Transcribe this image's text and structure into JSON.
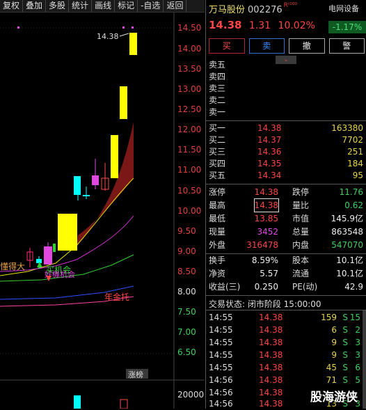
{
  "toolbar": {
    "items": [
      "复权",
      "叠加",
      "多股",
      "统计",
      "画线",
      "标记",
      "-自选",
      "返回"
    ]
  },
  "chart": {
    "price_axis_labels": [
      "14.50",
      "14.00",
      "13.50",
      "13.00",
      "12.50",
      "12.00",
      "11.50",
      "11.00",
      "10.50",
      "10.00",
      "9.50",
      "9.00",
      "8.50",
      "8.00",
      "7.50",
      "7.00",
      "6.50"
    ],
    "high_label": "14.38",
    "annotations": {
      "label1": "懂得大",
      "label2": "买机会",
      "label3": "好機机会",
      "label4": "年金托"
    },
    "zhangbang_label": "涨榜",
    "volume_axis_label": "20000",
    "colors": {
      "up_candle": "#ff2a7a",
      "limit_up_candle": "#ffff00",
      "down_candle": "#00ffff",
      "ma_yellow": "#e8e000",
      "ma_magenta": "#d030d0",
      "ma_green": "#30d030",
      "ma_blue": "#3050ff",
      "cloud": "#7a1515"
    }
  },
  "header": {
    "stock_name": "万马股份",
    "stock_code": "002276",
    "r_tag": "R⁽⁰⁰⁰",
    "sector_name": "电网设备",
    "price": "14.38",
    "change": "1.31",
    "change_pct": "10.02%",
    "sector_pct": "-1.17%"
  },
  "buttons": {
    "buy": "买",
    "sell": "卖",
    "cancel": "撤",
    "warn": "警"
  },
  "fold_icon": "chevron-down-double",
  "asks": [
    {
      "label": "卖五",
      "price": "",
      "vol": ""
    },
    {
      "label": "卖四",
      "price": "",
      "vol": ""
    },
    {
      "label": "卖三",
      "price": "",
      "vol": ""
    },
    {
      "label": "卖二",
      "price": "",
      "vol": ""
    },
    {
      "label": "卖一",
      "price": "",
      "vol": ""
    }
  ],
  "bids": [
    {
      "label": "买一",
      "price": "14.38",
      "vol": "163380"
    },
    {
      "label": "买二",
      "price": "14.37",
      "vol": "7702"
    },
    {
      "label": "买三",
      "price": "14.36",
      "vol": "251"
    },
    {
      "label": "买四",
      "price": "14.35",
      "vol": "184"
    },
    {
      "label": "买五",
      "price": "14.34",
      "vol": "95"
    }
  ],
  "stats": [
    {
      "l1": "涨停",
      "v1": "14.38",
      "c1": "red",
      "l2": "跌停",
      "v2": "11.76",
      "c2": "green"
    },
    {
      "l1": "最高",
      "v1": "14.38",
      "c1": "red",
      "l2": "量比",
      "v2": "0.62",
      "c2": "green"
    },
    {
      "l1": "最低",
      "v1": "13.85",
      "c1": "red",
      "l2": "市值",
      "v2": "145.9亿",
      "c2": "white"
    },
    {
      "l1": "现量",
      "v1": "3452",
      "c1": "magenta",
      "l2": "总量",
      "v2": "863548",
      "c2": "white"
    },
    {
      "l1": "外盘",
      "v1": "316478",
      "c1": "red",
      "l2": "内盘",
      "v2": "547070",
      "c2": "green"
    }
  ],
  "stats2": [
    {
      "l1": "换手",
      "v1": "8.59%",
      "c1": "white",
      "l2": "股本",
      "v2": "10.1亿",
      "c2": "white"
    },
    {
      "l1": "净资",
      "v1": "5.57",
      "c1": "white",
      "l2": "流通",
      "v2": "10.1亿",
      "c2": "white"
    },
    {
      "l1": "收益(三)",
      "v1": "0.250",
      "c1": "white",
      "l2": "PE(动)",
      "v2": "42.9",
      "c2": "white"
    }
  ],
  "trade_state": "交易状态: 闭市阶段 15:00:00",
  "ticks": [
    {
      "time": "14:55",
      "price": "14.38",
      "vol": "159",
      "side": "S",
      "num": "15"
    },
    {
      "time": "14:55",
      "price": "14.38",
      "vol": "6",
      "side": "S",
      "num": "2"
    },
    {
      "time": "14:55",
      "price": "14.38",
      "vol": "9",
      "side": "S",
      "num": "3"
    },
    {
      "time": "14:55",
      "price": "14.38",
      "vol": "9",
      "side": "S",
      "num": "3"
    },
    {
      "time": "14:55",
      "price": "14.38",
      "vol": "45",
      "side": "S",
      "num": "6"
    },
    {
      "time": "14:56",
      "price": "14.38",
      "vol": "71",
      "side": "S",
      "num": "5"
    },
    {
      "time": "14:56",
      "price": "14.38",
      "vol": "",
      "side": "",
      "num": ""
    },
    {
      "time": "14:56",
      "price": "14.38",
      "vol": "13",
      "side": "S",
      "num": "3"
    }
  ],
  "watermark": "股海游侠"
}
